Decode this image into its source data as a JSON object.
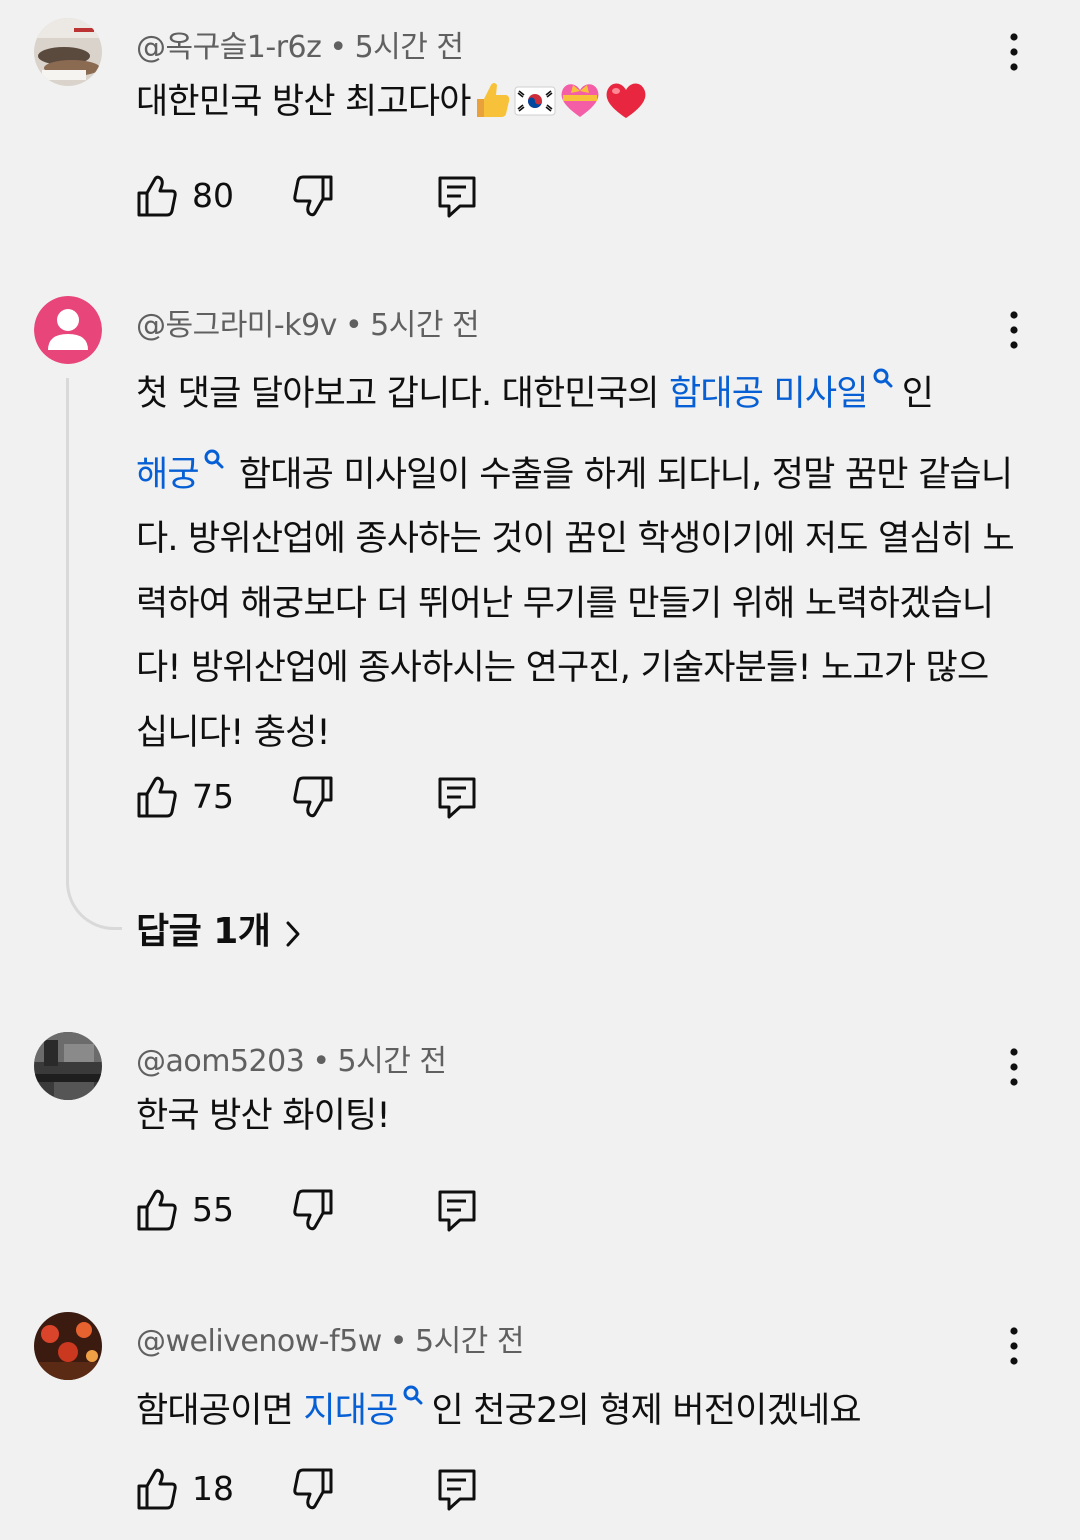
{
  "comments": [
    {
      "author": "@옥구슬1-r6z",
      "time": "5시간 전",
      "text_plain": "대한민국  방산  최고다아",
      "emojis": [
        "thumbs-up-emoji",
        "korea-flag-emoji",
        "heart-with-ribbon-emoji",
        "red-heart-emoji"
      ],
      "likes": "80"
    },
    {
      "author": "@동그라미-k9v",
      "time": "5시간 전",
      "text_a": "첫 댓글 달아보고 갑니다. 대한민국의 ",
      "link_a": "함대공 미사일",
      "text_b": "인",
      "link_b": "해궁",
      "text_c": "함대공 미사일이 수출을 하게 되다니, 정말 꿈만 같습니다. 방위산업에 종사하는 것이 꿈인 학생이기에 저도 열심히 노력하여 해궁보다 더 뛰어난 무기를 만들기 위해 노력하겠습니다! 방위산업에 종사하시는 연구진, 기술자분들! 노고가 많으십니다! 충성!",
      "likes": "75",
      "replies_label": "답글 1개"
    },
    {
      "author": "@aom5203",
      "time": "5시간 전",
      "text_plain": "한국 방산 화이팅!",
      "likes": "55"
    },
    {
      "author": "@welivenow-f5w",
      "time": "5시간 전",
      "text_a": "함대공이면 ",
      "link_a": "지대공",
      "text_b": "인 천궁2의 형제 버전이겠네요",
      "likes": "18"
    }
  ],
  "colors": {
    "background": "#f1f1f1",
    "link": "#065fd4",
    "meta": "#606060",
    "avatar_default": "#e8457a"
  }
}
